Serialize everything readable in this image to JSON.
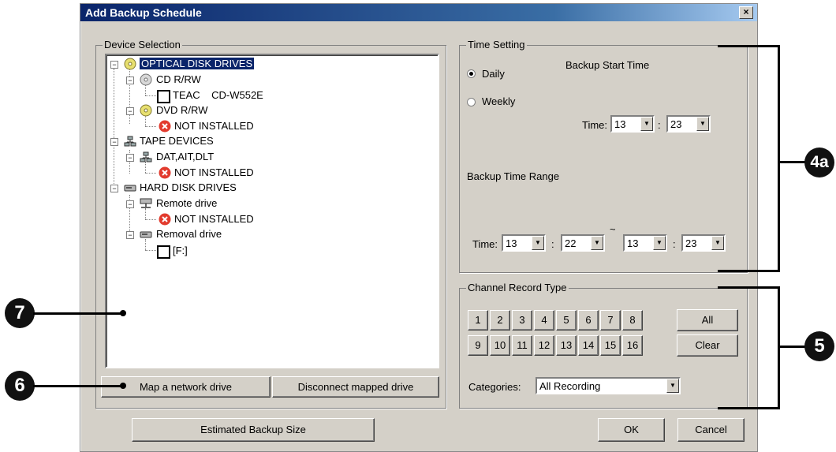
{
  "dialog": {
    "title": "Add Backup Schedule",
    "close_label": "×"
  },
  "device_selection": {
    "legend": "Device Selection",
    "tree": {
      "optical": "OPTICAL DISK DRIVES",
      "cd": "CD R/RW",
      "cd_device": "TEAC    CD-W552E",
      "dvd": "DVD R/RW",
      "dvd_status": "NOT INSTALLED",
      "tape": "TAPE DEVICES",
      "dat": "DAT,AIT,DLT",
      "dat_status": "NOT INSTALLED",
      "hdd": "HARD DISK DRIVES",
      "remote": "Remote drive",
      "remote_status": "NOT INSTALLED",
      "removal": "Removal drive",
      "removal_device": "[F:]"
    },
    "map_button": "Map a network drive",
    "disconnect_button": "Disconnect mapped drive"
  },
  "time_setting": {
    "legend": "Time Setting",
    "daily": "Daily",
    "weekly": "Weekly",
    "selected": "Daily",
    "start_time_label": "Backup Start Time",
    "time_label": "Time:",
    "start_hour": "13",
    "start_minute": "23",
    "colon": ":",
    "range_label": "Backup Time Range",
    "range_time_label": "Time:",
    "range_from_hour": "13",
    "range_from_minute": "22",
    "tilde": "~",
    "range_to_hour": "13",
    "range_to_minute": "23"
  },
  "channel": {
    "legend": "Channel Record Type",
    "row1": [
      "1",
      "2",
      "3",
      "4",
      "5",
      "6",
      "7",
      "8"
    ],
    "row2": [
      "9",
      "10",
      "11",
      "12",
      "13",
      "14",
      "15",
      "16"
    ],
    "all_button": "All",
    "clear_button": "Clear",
    "categories_label": "Categories:",
    "categories_value": "All Recording"
  },
  "footer": {
    "estimate_button": "Estimated Backup Size",
    "ok_button": "OK",
    "cancel_button": "Cancel"
  },
  "callouts": {
    "c4a": "4a",
    "c5": "5",
    "c6": "6",
    "c7": "7"
  },
  "colors": {
    "selection": "#0a246a",
    "dialog_bg": "#d4d0c8",
    "error_icon": "#e23b2e"
  }
}
